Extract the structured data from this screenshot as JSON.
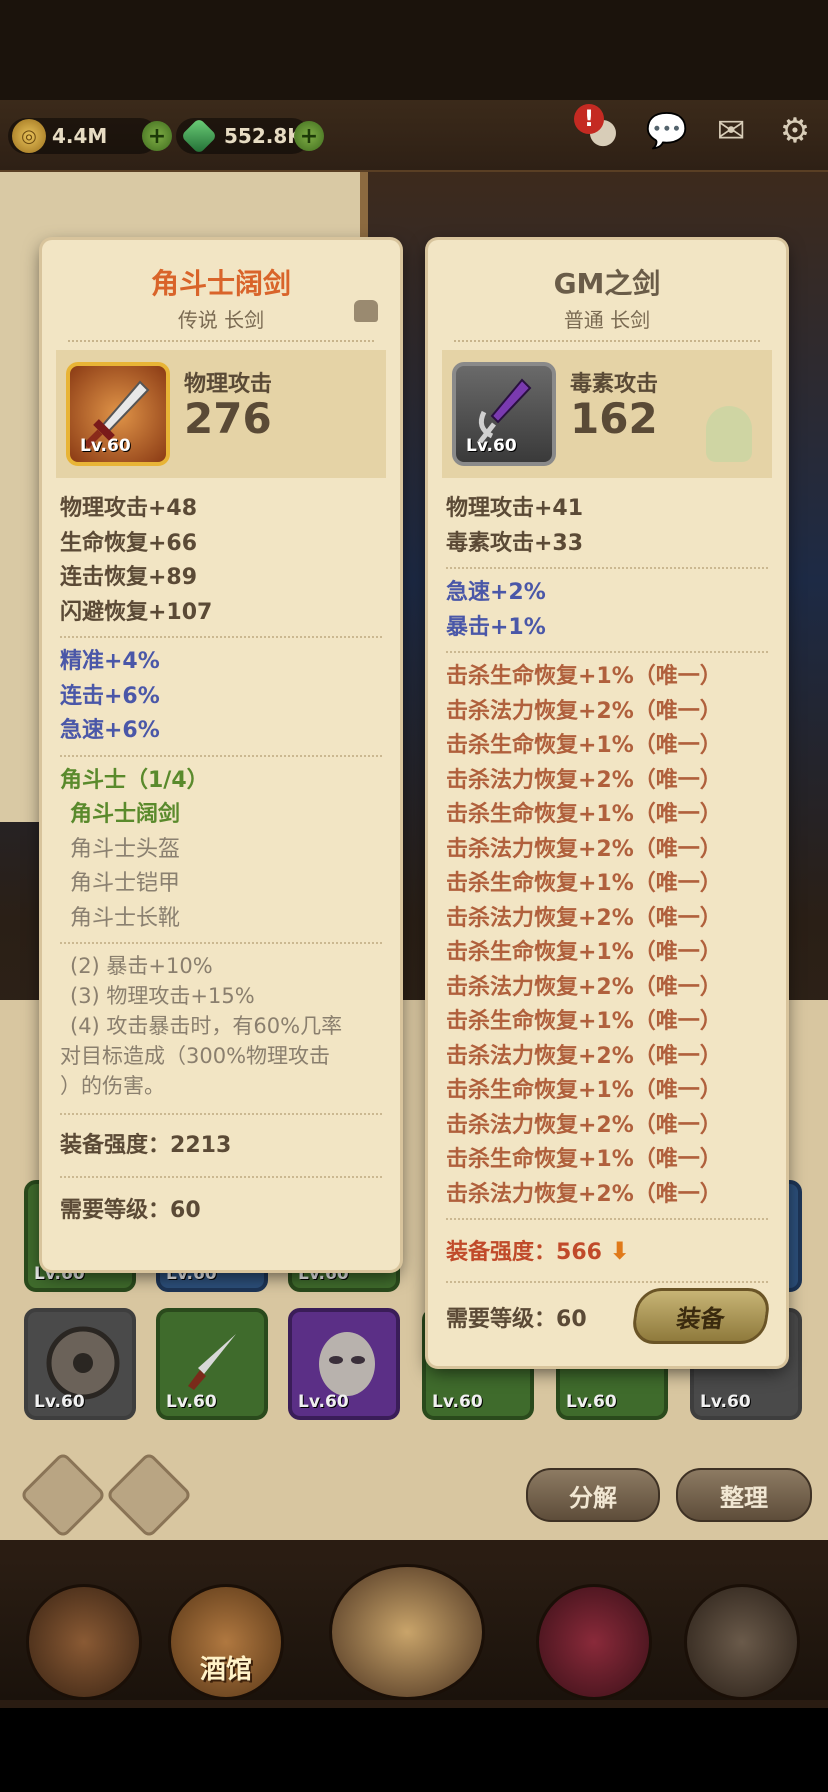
{
  "currency": {
    "gold": "4.4M",
    "gems": "552.8K",
    "alert_badge": "!"
  },
  "left_card": {
    "title": "角斗士阔剑",
    "title_color": "#d9642a",
    "subtitle": "传说 长剑",
    "stat_label": "物理攻击",
    "stat_value": "276",
    "level": "Lv.60",
    "base_stats": [
      "物理攻击+48",
      "生命恢复+66",
      "连击恢复+89",
      "闪避恢复+107"
    ],
    "bonus_stats": [
      "精准+4%",
      "连击+6%",
      "急速+6%"
    ],
    "set_title": "角斗士（1/4）",
    "set_items": [
      {
        "name": "角斗士阔剑",
        "owned": true
      },
      {
        "name": "角斗士头盔",
        "owned": false
      },
      {
        "name": "角斗士铠甲",
        "owned": false
      },
      {
        "name": "角斗士长靴",
        "owned": false
      }
    ],
    "set_bonuses": [
      "(2) 暴击+10%",
      "(3) 物理攻击+15%",
      "(4) 攻击暴击时，有60%几率",
      "对目标造成（300%物理攻击",
      "）的伤害。"
    ],
    "power_label": "装备强度：",
    "power_value": "2213",
    "req_label": "需要等级：",
    "req_value": "60"
  },
  "right_card": {
    "title": "GM之剑",
    "title_color": "#6a5c48",
    "subtitle": "普通 长剑",
    "stat_label": "毒素攻击",
    "stat_value": "162",
    "level": "Lv.60",
    "base_stats": [
      "物理攻击+41",
      "毒素攻击+33"
    ],
    "bonus_stats": [
      "急速+2%",
      "暴击+1%"
    ],
    "unique_stats": [
      "击杀生命恢复+1%（唯一）",
      "击杀法力恢复+2%（唯一）",
      "击杀生命恢复+1%（唯一）",
      "击杀法力恢复+2%（唯一）",
      "击杀生命恢复+1%（唯一）",
      "击杀法力恢复+2%（唯一）",
      "击杀生命恢复+1%（唯一）",
      "击杀法力恢复+2%（唯一）",
      "击杀生命恢复+1%（唯一）",
      "击杀法力恢复+2%（唯一）",
      "击杀生命恢复+1%（唯一）",
      "击杀法力恢复+2%（唯一）",
      "击杀生命恢复+1%（唯一）",
      "击杀法力恢复+2%（唯一）",
      "击杀生命恢复+1%（唯一）",
      "击杀法力恢复+2%（唯一）"
    ],
    "power_label": "装备强度：",
    "power_value": "566",
    "req_label": "需要等级：",
    "req_value": "60",
    "equip_button": "装备"
  },
  "inventory": {
    "level_label": "Lv.60"
  },
  "bottom_buttons": {
    "disassemble": "分解",
    "sort": "整理"
  },
  "nav": {
    "tavern": "酒馆"
  }
}
